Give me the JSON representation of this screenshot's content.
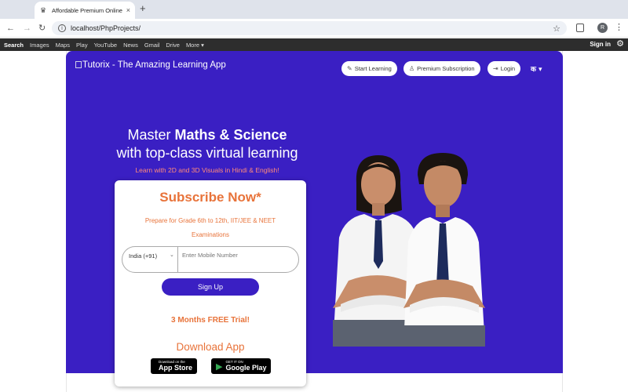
{
  "browser": {
    "tab_title": "Affordable Premium Online Le",
    "tab_close": "×",
    "new_tab": "+",
    "url": "localhost/PhpProjects/",
    "avatar_letter": "R"
  },
  "google_bar": {
    "links": [
      "Search",
      "Images",
      "Maps",
      "Play",
      "YouTube",
      "News",
      "Gmail",
      "Drive",
      "More ▾"
    ],
    "sign_in": "Sign in"
  },
  "header": {
    "logo_text": "Tutorix - The Amazing Learning App",
    "start_learning": "Start Learning",
    "premium": "Premium Subscription",
    "login": "Login",
    "language": "क ▾"
  },
  "hero": {
    "headline_pre": "Master ",
    "headline_bold": "Maths & Science",
    "headline_line2": "with top-class virtual learning",
    "subline": "Learn with 2D and 3D Visuals in Hindi & English!"
  },
  "signup_card": {
    "title": "Subscribe Now*",
    "subtitle": "Prepare for Grade 6th to 12th, IIT/JEE & NEET Examinations",
    "country": "India (+91)",
    "phone_placeholder": "Enter Mobile Number",
    "signup_button": "Sign Up",
    "trial": "3 Months FREE Trial!",
    "download": "Download App",
    "app_store_small": "Download on the",
    "app_store_big": "App Store",
    "play_small": "GET IT ON",
    "play_big": "Google Play"
  },
  "colors": {
    "hero_bg": "#3a1fc3",
    "accent_orange": "#e8733a",
    "subline": "#ff8a7a"
  }
}
